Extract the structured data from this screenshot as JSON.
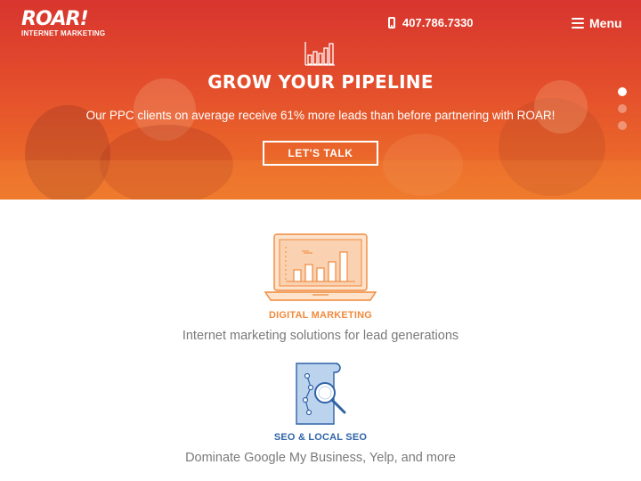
{
  "header": {
    "logo_main": "ROAR!",
    "logo_sub": "INTERNET MARKETING",
    "phone": "407.786.7330",
    "menu_label": "Menu"
  },
  "hero": {
    "title": "GROW YOUR PIPELINE",
    "subtitle": "Our PPC clients on average receive 61% more leads than before partnering with ROAR!",
    "cta_label": "LET'S TALK",
    "slide_count": 3,
    "active_slide": 1
  },
  "services": [
    {
      "icon": "laptop-bar-chart-icon",
      "title": "DIGITAL MARKETING",
      "description": "Internet marketing solutions for lead generations",
      "color": "#f08a3c"
    },
    {
      "icon": "document-magnifier-icon",
      "title": "SEO & LOCAL SEO",
      "description": "Dominate Google My Business, Yelp, and more",
      "color": "#2f63a6"
    }
  ],
  "colors": {
    "hero_top": "#d8352e",
    "hero_bottom": "#ee7628",
    "accent_orange": "#f08a3c",
    "accent_blue": "#2f63a6"
  }
}
